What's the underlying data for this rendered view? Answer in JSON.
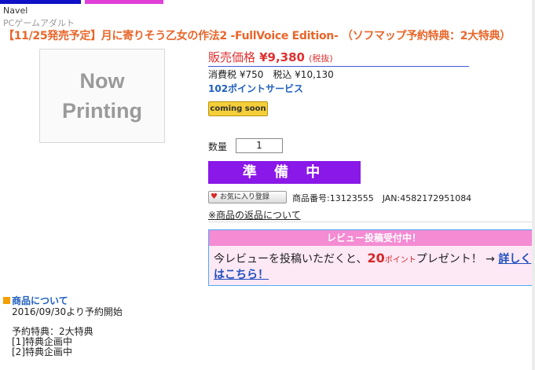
{
  "header": {
    "maker": "Navel",
    "category": "PCゲームアダルト",
    "title": "【11/25発売予定】月に寄りそう乙女の作法2 -FullVoice Edition- （ソフマップ予約特典：2大特典）"
  },
  "image": {
    "line1": "Now",
    "line2": "Printing"
  },
  "price": {
    "label": "販売価格",
    "value": "¥9,380",
    "tax_note": "(税抜)",
    "tax_line": "消費税 ¥750　税込 ¥10,130",
    "points": "102ポイントサービス"
  },
  "status_badge": "coming soon",
  "quantity": {
    "label": "数量",
    "value": "1"
  },
  "prep_button": "準 備 中",
  "favorite_button": "お気に入り登録",
  "product_info": "商品番号:13123555　JAN:4582172951084",
  "returns_link": "※商品の返品について",
  "review": {
    "header": "レビュー投稿受付中！",
    "text_before": "今レビューを投稿いただくと、",
    "points": "20",
    "points_unit": "ポイント",
    "text_after": "プレゼント！ → ",
    "link_part1": "詳しく",
    "link_part2": "はこちら！"
  },
  "about": {
    "heading": "商品について",
    "lines": [
      "2016/09/30より予約開始",
      "",
      "予約特典：2大特典",
      "[1]特典企画中",
      "[2]特典企画中"
    ]
  },
  "colors": {
    "title": "#e8662a",
    "price": "#e03131",
    "prep_button": "#8a18e8",
    "review_header": "#f48bd3",
    "link": "#1f5fbf"
  }
}
